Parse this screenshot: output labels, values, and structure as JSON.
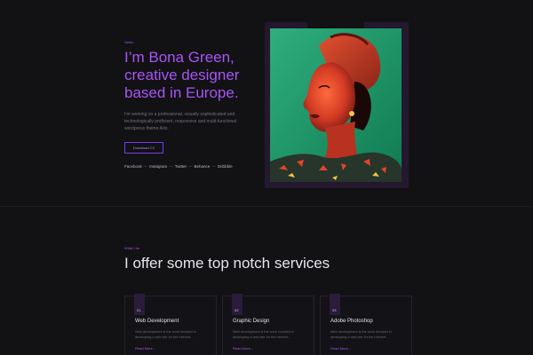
{
  "hero": {
    "greeting": "Hello!",
    "title_line1": "I’m Bona Green,",
    "title_line2": "creative designer",
    "title_line3": "based in Europe.",
    "description": "I’m working on a professional, visually sophisticated and technologically proficient, responsive and multi-functional wordpress theme Arlo.",
    "download_label": "Download CV",
    "social": [
      "Facebook",
      "Instagram",
      "Twitter",
      "Behance",
      "Dribbble"
    ],
    "social_separator": "—"
  },
  "services": {
    "kicker": "What I do",
    "title": "I offer some top notch services",
    "cards": [
      {
        "num": "01",
        "title": "Web Development",
        "desc": "Web development is the work involved in developing a web site for the Internet...",
        "link": "Read More..."
      },
      {
        "num": "02",
        "title": "Graphic Design",
        "desc": "Web development is the work involved in developing a web site for the Internet...",
        "link": "Read More..."
      },
      {
        "num": "03",
        "title": "Adobe Photoshop",
        "desc": "Web development is the work involved in developing a web site for the Internet...",
        "link": "Read More..."
      }
    ]
  },
  "colors": {
    "accent": "#a855f7",
    "background": "#121114",
    "portrait_green": "#1f9d6e",
    "portrait_red": "#e0452b"
  }
}
